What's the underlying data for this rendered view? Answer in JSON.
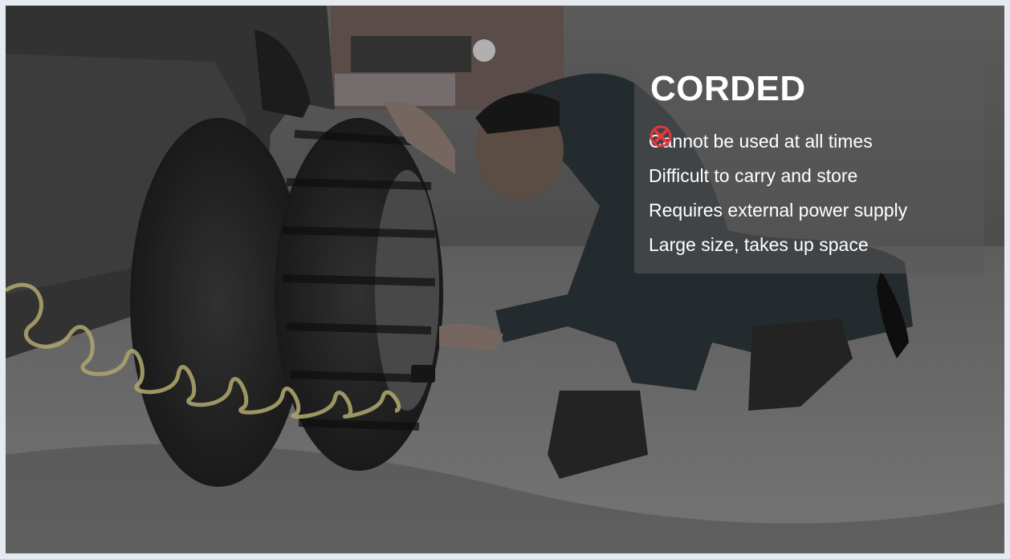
{
  "panel": {
    "title": "CORDED",
    "cons": [
      {
        "label": "Cannot be used at all times",
        "icon": "red-x-icon"
      },
      {
        "label": "Difficult to carry and store",
        "icon": "red-x-icon"
      },
      {
        "label": "Requires external power supply",
        "icon": "red-x-icon"
      },
      {
        "label": "Large size, takes up space",
        "icon": "red-x-icon"
      }
    ]
  },
  "colors": {
    "accent": "#e8373d",
    "panel_text": "#ffffff",
    "hose": "#c9bf80"
  },
  "photo": {
    "subject": "man inflating an off-road vehicle tire with a coiled air hose"
  }
}
